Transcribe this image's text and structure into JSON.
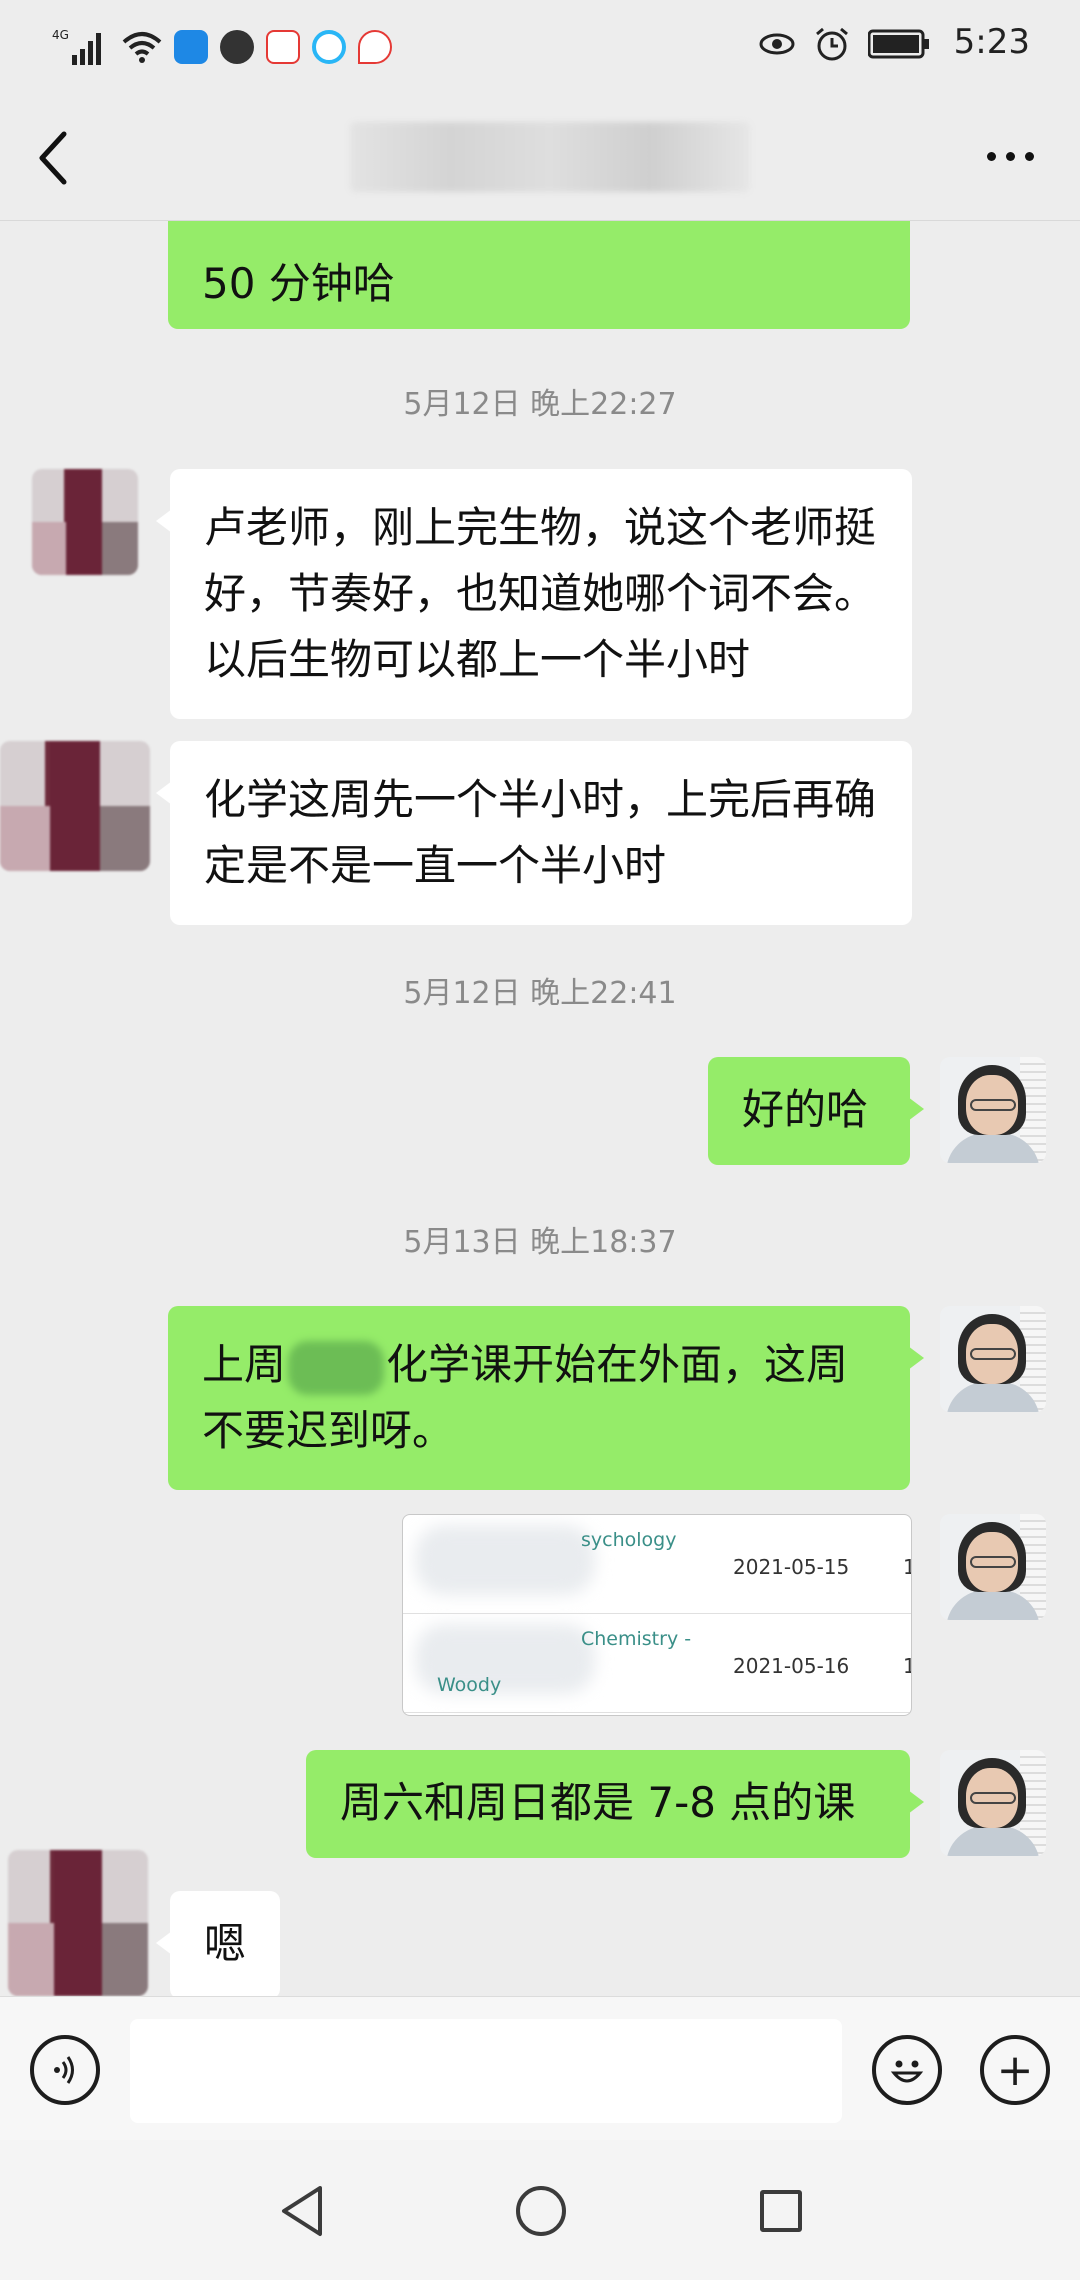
{
  "status_bar": {
    "network_label": "4G",
    "time": "5:23",
    "icons": [
      "signal-icon",
      "wifi-icon",
      "shield-app-icon",
      "bird-app-icon",
      "baidu-app-icon",
      "browser-app-icon",
      "map-pin-app-icon",
      "eye-icon",
      "alarm-icon",
      "battery-icon"
    ]
  },
  "header": {
    "title": "202",
    "back_icon": "chevron-left-icon",
    "more_icon": "more-dots-icon"
  },
  "messages": {
    "m0_partial": "50 分钟哈",
    "ts1": "5月12日 晚上22:27",
    "m1": "卢老师，刚上完生物，说这个老师挺好，节奏好，也知道她哪个词不会。以后生物可以都上一个半小时",
    "m2": "化学这周先一个半小时，上完后再确定是不是一直一个半小时",
    "ts2": "5月12日 晚上22:41",
    "m3": "好的哈",
    "ts3": "5月13日 晚上18:37",
    "m4_part1": "上周",
    "m4_part2": "化学课开始在外面，这周不要迟到呀。",
    "m5": "周六和周日都是 7-8 点的课",
    "m6": "嗯"
  },
  "image_card": {
    "rows": [
      {
        "course": "sychology",
        "sub": "",
        "date": "2021-05-15",
        "trail": "1"
      },
      {
        "course": "Chemistry -",
        "sub": "Woody",
        "date": "2021-05-16",
        "trail": "1"
      }
    ]
  },
  "input_bar": {
    "voice_icon": "voice-icon",
    "emoji_icon": "emoji-icon",
    "plus_icon": "plus-icon",
    "plus_glyph": "+"
  },
  "nav_bar": {
    "icons": [
      "nav-back-icon",
      "nav-home-icon",
      "nav-recent-icon"
    ]
  },
  "colors": {
    "bubble_green": "#95ec69",
    "bubble_white": "#ffffff",
    "background": "#ededed"
  }
}
